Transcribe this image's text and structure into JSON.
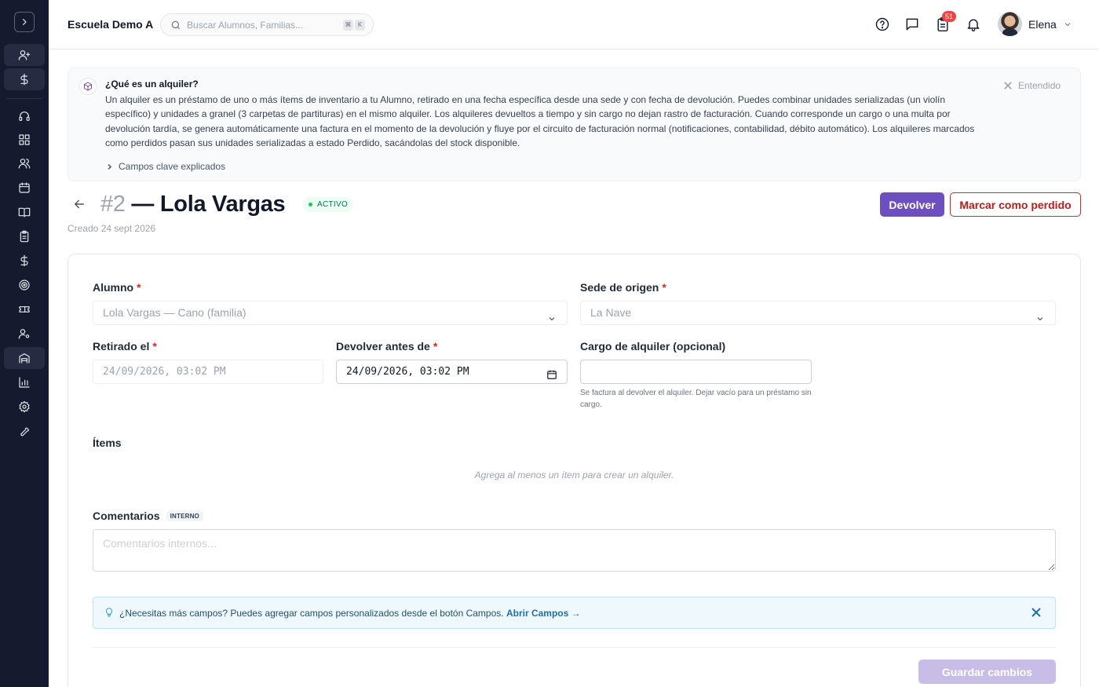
{
  "header": {
    "school_name": "Escuela Demo A",
    "search_placeholder": "Buscar Alumnos, Familias...",
    "search_kbd_1": "⌘",
    "search_kbd_2": "K",
    "tasks_badge": "51",
    "user_name": "Elena"
  },
  "sidebar": {
    "icons": [
      "chevron-right-icon",
      "user-plus-icon",
      "dollar-icon",
      "headset-icon",
      "grid-icon",
      "users-icon",
      "calendar-icon",
      "book-icon",
      "clipboard-icon",
      "dollar-icon",
      "target-icon",
      "ticket-icon",
      "user-settings-icon",
      "inventory-icon",
      "chart-icon",
      "gear-icon",
      "wrench-icon"
    ]
  },
  "info": {
    "title": "¿Qué es un alquiler?",
    "text": "Un alquiler es un préstamo de uno o más ítems de inventario a tu Alumno, retirado en una fecha específica desde una sede y con fecha de devolución. Puedes combinar unidades serializadas (un violín específico) y unidades a granel (3 carpetas de partituras) en el mismo alquiler. Los alquileres devueltos a tiempo y sin cargo no dejan rastro de facturación. Cuando corresponde un cargo o una multa por devolución tardía, se genera automáticamente una factura en el momento de la devolución y fluye por el circuito de facturación normal (notificaciones, contabilidad, débito automático). Los alquileres marcados como perdidos pasan sus unidades serializadas a estado Perdido, sacándolas del stock disponible.",
    "dismiss_label": "Entendido",
    "more_label": "Campos clave explicados"
  },
  "rental": {
    "number": "#2",
    "separator": " — ",
    "name": "Lola Vargas",
    "status": "ACTIVO",
    "created": "Creado 24 sept 2026",
    "return_button": "Devolver",
    "lost_button": "Marcar como perdido"
  },
  "form": {
    "student_label": "Alumno",
    "student_value": "Lola Vargas — Cano (familia)",
    "location_label": "Sede de origen",
    "location_value": "La Nave",
    "checkout_label": "Retirado el",
    "checkout_value": "24/09/2026, 03:02 PM",
    "due_label": "Devolver antes de",
    "due_value": "24/09/2026, 03:02 PM",
    "fee_label": "Cargo de alquiler (opcional)",
    "fee_value": "",
    "fee_help": "Se factura al devolver el alquiler. Dejar vacío para un préstamo sin cargo.",
    "required_mark": "*",
    "items_label": "Ítems",
    "items_empty": "Agrega al menos un ítem para crear un alquiler.",
    "comments_label": "Comentarios",
    "comments_tag": "INTERNO",
    "comments_placeholder": "Comentarios internos...",
    "tip_text": "¿Necesitas más campos? Puedes agregar campos personalizados desde el botón Campos.",
    "tip_link": "Abrir Campos →",
    "save_button": "Guardar cambios"
  },
  "colors": {
    "sidebar_bg": "#161a2e",
    "primary": "#6d4fc2",
    "danger": "#dc2626",
    "success": "#047857"
  }
}
